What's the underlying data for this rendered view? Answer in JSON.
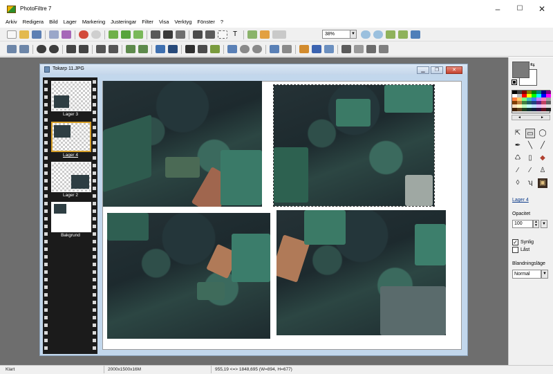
{
  "app": {
    "title": "PhotoFiltre 7"
  },
  "window_controls": {
    "minimize": "–",
    "maximize": "☐",
    "close": "✕"
  },
  "menu": [
    "Arkiv",
    "Redigera",
    "Bild",
    "Lager",
    "Markering",
    "Justeringar",
    "Filter",
    "Visa",
    "Verktyg",
    "Fönster",
    "?"
  ],
  "toolbar": {
    "zoom": "38%"
  },
  "document": {
    "title": "Tokarp 11.JPG",
    "btn_min": "▁",
    "btn_max": "❐",
    "btn_close": "✕"
  },
  "layers": [
    {
      "label": "Lager 3"
    },
    {
      "label": "Lager 4"
    },
    {
      "label": "Lager 2"
    },
    {
      "label": "Bakgrund"
    }
  ],
  "panel": {
    "layer_name": "Lager 4",
    "opacity_label": "Opacitet",
    "opacity_value": "100",
    "visible_label": "Synlig",
    "visible_checked": "✓",
    "locked_label": "Låst",
    "blend_label": "Blandningsläge",
    "blend_value": "Normal"
  },
  "status": {
    "state": "Klart",
    "image_info": "2000x1500x16M",
    "coords": "955,19 <=> 1848,695 (W=894, H=677)"
  },
  "colors": {
    "accent": "#d8a12b",
    "title_bar": "#c4d6ea",
    "workspace": "#6e6e6e"
  }
}
